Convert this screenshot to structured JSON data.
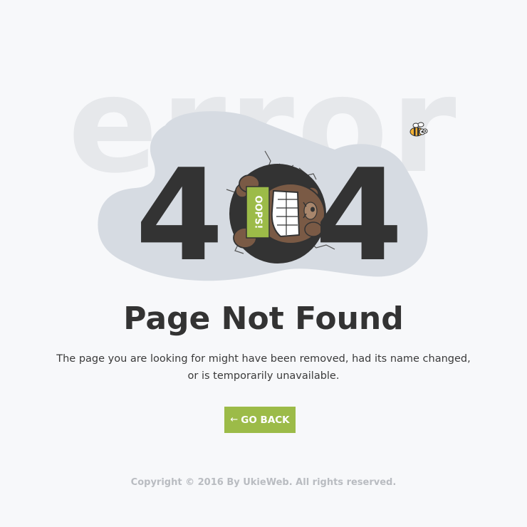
{
  "hero": {
    "background_word": "error",
    "code_left": "4",
    "code_right": "4",
    "sign_text": "OOPS!"
  },
  "heading": "Page Not Found",
  "description": {
    "line1": "The page you are looking for might have been removed, had its name changed,",
    "line2": "or is temporarily unavailable."
  },
  "button": {
    "arrow": "←",
    "label": "GO BACK"
  },
  "footer": {
    "copyright": "Copyright © 2016 By UkieWeb. All rights reserved."
  },
  "colors": {
    "background": "#f7f8fa",
    "accent": "#9cbb48",
    "text": "#333333",
    "blob": "#d6dbe2",
    "bg_word": "#e6e8eb"
  }
}
